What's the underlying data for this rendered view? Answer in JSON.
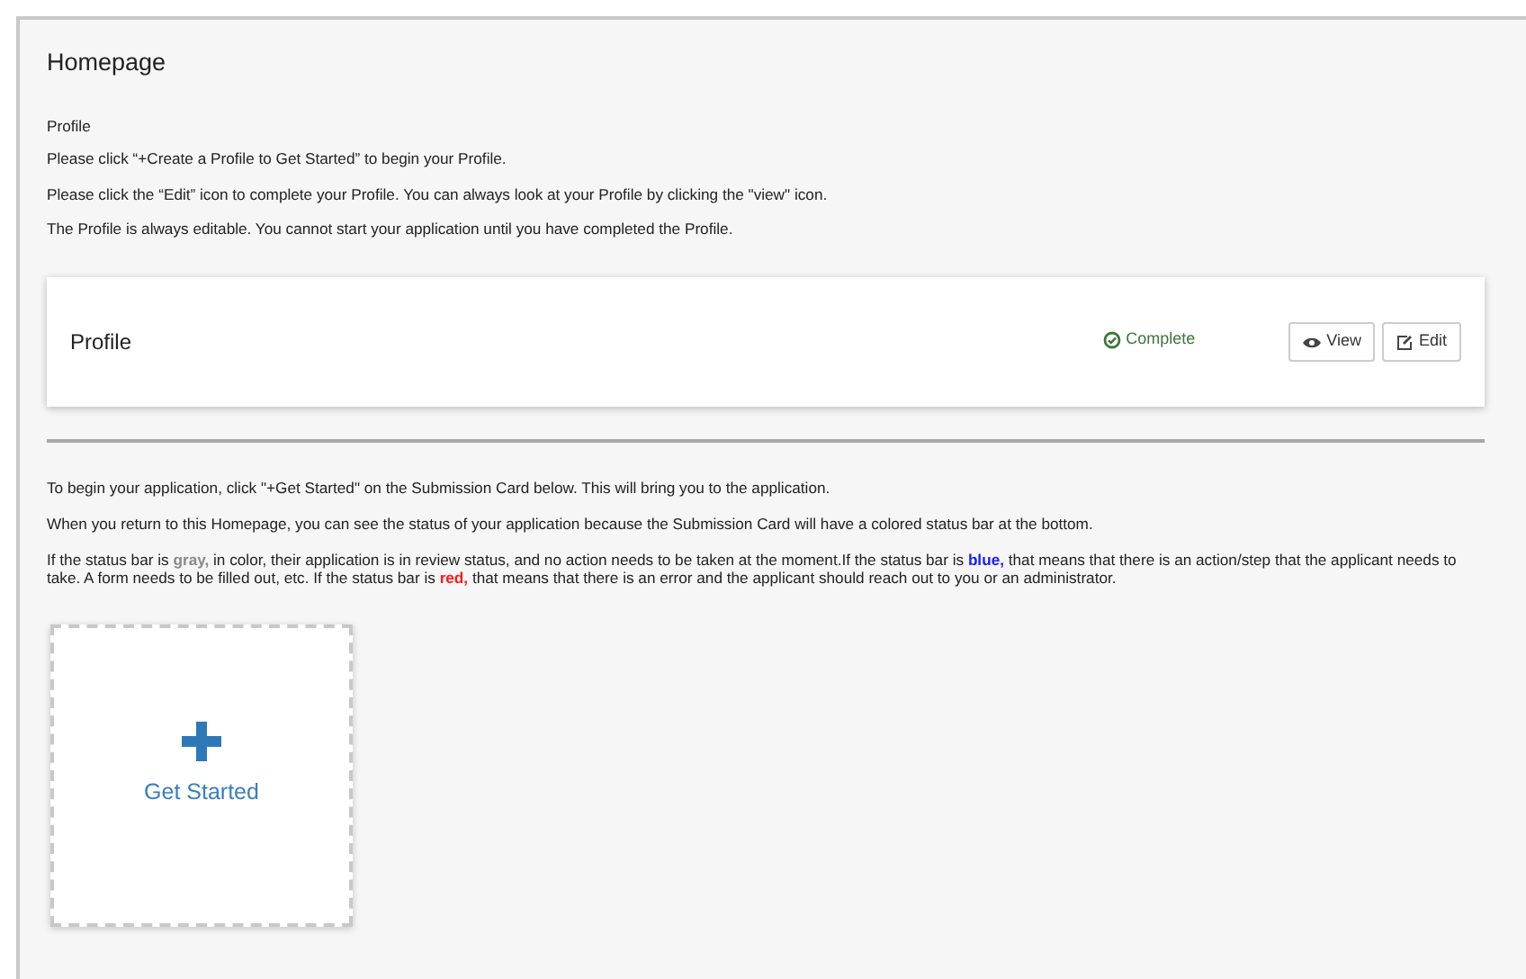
{
  "page_title": "Homepage",
  "intro": {
    "heading": "Profile",
    "lines": [
      "Please click “+Create a Profile to Get Started” to begin your Profile.",
      "Please click the “Edit” icon to complete your Profile. You can always look at your Profile by clicking the \"view\" icon.",
      "The Profile is always editable. You cannot start your application until you have completed the Profile."
    ]
  },
  "profile_card": {
    "title": "Profile",
    "status": "Complete",
    "buttons": [
      {
        "kind": "view",
        "label": "View"
      },
      {
        "kind": "edit",
        "label": "Edit"
      }
    ]
  },
  "instructions": [
    [
      {
        "text": "To begin your application, click \"+Get Started\" on the Submission Card below. This will bring you to the application."
      }
    ],
    [
      {
        "text": "When you return to this Homepage, you can see the status of your application because the Submission Card will have a colored status bar at the bottom."
      }
    ],
    [
      {
        "text": "If the status bar is "
      },
      {
        "text": "gray,",
        "color": "#8a8a8a"
      },
      {
        "text": " in color, their application is in review status, and no action needs to be taken at the moment.If the status bar is "
      },
      {
        "text": "blue,",
        "color": "#1a1aff"
      },
      {
        "text": " that means that there is an action/step that the applicant needs to take. A form needs to be filled out, etc. If the status bar is "
      },
      {
        "text": "red,",
        "color": "#ff1a1a"
      },
      {
        "text": " that means that there is an error and the applicant should reach out to you or an administrator."
      }
    ]
  ],
  "get_started_card": {
    "label": "Get Started"
  }
}
